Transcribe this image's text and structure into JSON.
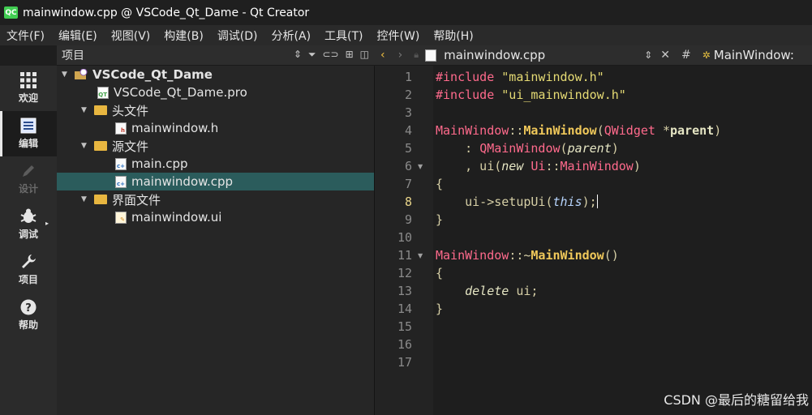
{
  "window": {
    "title": "mainwindow.cpp @ VSCode_Qt_Dame - Qt Creator",
    "logo": "QC"
  },
  "menu": [
    "文件(F)",
    "编辑(E)",
    "视图(V)",
    "构建(B)",
    "调试(D)",
    "分析(A)",
    "工具(T)",
    "控件(W)",
    "帮助(H)"
  ],
  "modes": [
    {
      "label": "欢迎",
      "icon": "grid-icon",
      "state": "normal"
    },
    {
      "label": "编辑",
      "icon": "document-icon",
      "state": "active"
    },
    {
      "label": "设计",
      "icon": "pencil-icon",
      "state": "disabled"
    },
    {
      "label": "调试",
      "icon": "bug-icon",
      "state": "normal"
    },
    {
      "label": "项目",
      "icon": "wrench-icon",
      "state": "normal"
    },
    {
      "label": "帮助",
      "icon": "help-icon",
      "state": "normal"
    }
  ],
  "project_pane": {
    "title": "项目",
    "tree": [
      {
        "label": "VSCode_Qt_Dame",
        "level": 0,
        "expanded": true,
        "icon": "project-icon"
      },
      {
        "label": "VSCode_Qt_Dame.pro",
        "level": 1,
        "icon": "pro-file-icon"
      },
      {
        "label": "头文件",
        "level": 1,
        "expanded": true,
        "icon": "folder-icon"
      },
      {
        "label": "mainwindow.h",
        "level": 2,
        "icon": "header-file-icon"
      },
      {
        "label": "源文件",
        "level": 1,
        "expanded": true,
        "icon": "folder-icon"
      },
      {
        "label": "main.cpp",
        "level": 2,
        "icon": "cpp-file-icon"
      },
      {
        "label": "mainwindow.cpp",
        "level": 2,
        "icon": "cpp-file-icon",
        "selected": true
      },
      {
        "label": "界面文件",
        "level": 1,
        "expanded": true,
        "icon": "folder-icon"
      },
      {
        "label": "mainwindow.ui",
        "level": 2,
        "icon": "ui-file-icon"
      }
    ]
  },
  "editor": {
    "file_name": "mainwindow.cpp",
    "symbol": "MainWindow:",
    "hash": "#",
    "current_line": 8,
    "line_numbers": [
      "1",
      "2",
      "3",
      "4",
      "5",
      "6",
      "7",
      "8",
      "9",
      "10",
      "11",
      "12",
      "13",
      "14",
      "15",
      "16",
      "17"
    ]
  },
  "watermark": "CSDN @最后的糖留给我"
}
